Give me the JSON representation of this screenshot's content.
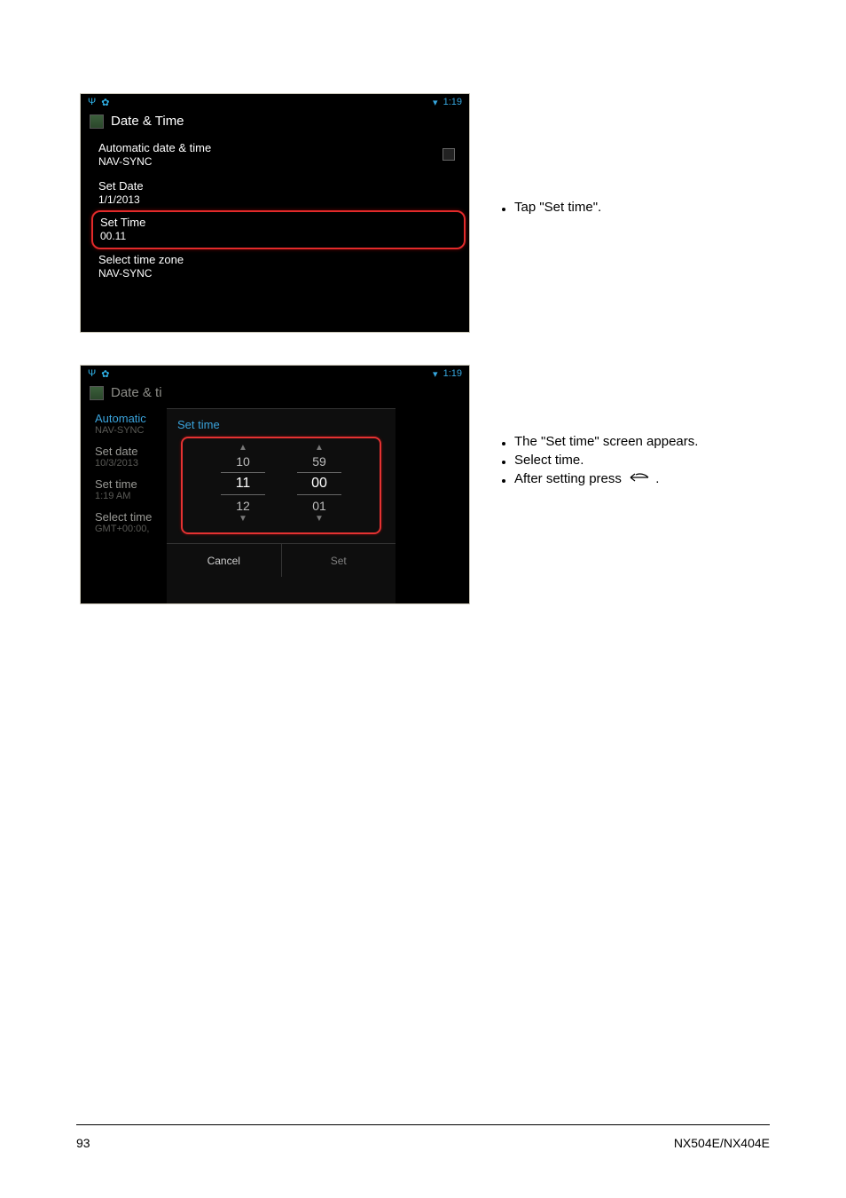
{
  "statusbar": {
    "time": "1:19"
  },
  "screen1": {
    "title": "Date & Time",
    "items": [
      {
        "primary": "Automatic date & time",
        "sub": "NAV-SYNC",
        "checkbox": true
      },
      {
        "primary": "Set Date",
        "sub": "1/1/2013"
      },
      {
        "primary": "Set Time",
        "sub": "00.11",
        "highlighted": true
      },
      {
        "primary": "Select time zone",
        "sub": "NAV-SYNC"
      }
    ]
  },
  "screen2": {
    "title": "Date & ti",
    "bg_items": [
      {
        "primary": "Automatic",
        "sub": "NAV-SYNC"
      },
      {
        "primary": "Set date",
        "sub": "10/3/2013"
      },
      {
        "primary": "Set time",
        "sub": "1:19 AM"
      },
      {
        "primary": "Select time",
        "sub": "GMT+00:00,"
      }
    ],
    "modal": {
      "title": "Set time",
      "hours": {
        "prev": "10",
        "sel": "11",
        "next": "12"
      },
      "minutes": {
        "prev": "59",
        "sel": "00",
        "next": "01"
      },
      "cancel": "Cancel",
      "set": "Set"
    }
  },
  "text": {
    "r1_bullet": "Tap \"Set time\".",
    "r2_b1": "The \"Set time\" screen appears.",
    "r2_b2": "Select time.",
    "r2_b3_a": "After setting press ",
    "r2_b3_b": "."
  },
  "footer": {
    "left": "93",
    "right": "NX504E/NX404E"
  }
}
